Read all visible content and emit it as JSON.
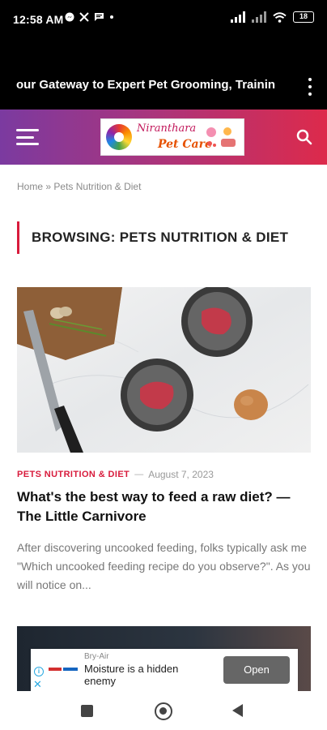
{
  "status_bar": {
    "time": "12:58 AM",
    "notification_icons": [
      "messenger-icon",
      "x-icon",
      "message-icon",
      "dot-icon"
    ],
    "battery": "18"
  },
  "browser": {
    "page_title": "our Gateway to Expert Pet Grooming, Trainin"
  },
  "site": {
    "logo_text_top": "Niranthara",
    "logo_text_bottom": "Pet Care",
    "brand_gradient": [
      "#7b3aa0",
      "#dd2a4b"
    ]
  },
  "breadcrumb": {
    "home": "Home",
    "separator": "»",
    "current": "Pets Nutrition & Diet"
  },
  "archive": {
    "heading": "BROWSING: PETS NUTRITION & DIET",
    "accent_color": "#d81b3c"
  },
  "articles": [
    {
      "category": "PETS NUTRITION & DIET",
      "dash": "—",
      "date": "August 7, 2023",
      "title": "What's the best way to feed a raw diet? — The Little Carnivore",
      "excerpt": "After discovering uncooked feeding, folks typically ask me \"Which uncooked feeding recipe do you observe?\". As you will notice on..."
    }
  ],
  "ad": {
    "advertiser": "Bry-Air",
    "title": "Moisture is a hidden enemy",
    "cta": "Open"
  }
}
